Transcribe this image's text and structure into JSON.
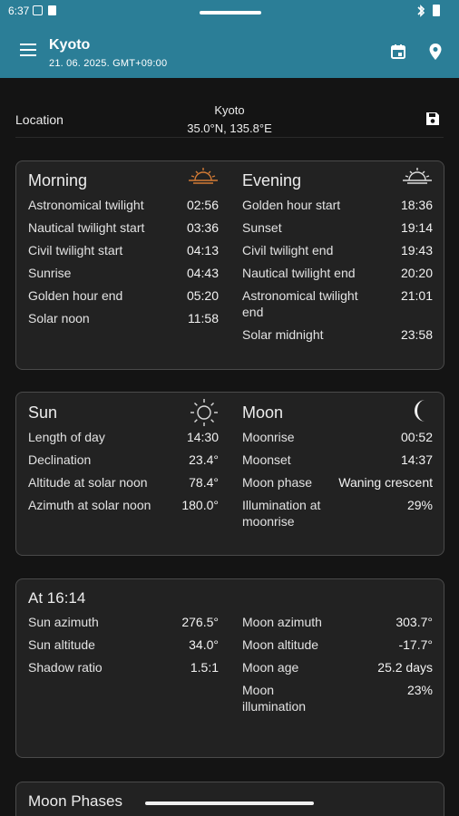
{
  "status_bar": {
    "time": "6:37"
  },
  "app_bar": {
    "title": "Kyoto",
    "subtitle": "21. 06. 2025.  GMT+09:00",
    "menu_icon": "menu-icon",
    "calendar_icon": "calendar-icon",
    "location_icon": "map-pin-icon"
  },
  "location": {
    "label": "Location",
    "name": "Kyoto",
    "coords": "35.0°N, 135.8°E",
    "save_icon": "save-icon"
  },
  "twilight_card": {
    "morning": {
      "title": "Morning",
      "icon": "sunrise-icon",
      "rows": [
        {
          "label": "Astronomical twilight",
          "value": "02:56"
        },
        {
          "label": "Nautical twilight start",
          "value": "03:36"
        },
        {
          "label": "Civil twilight start",
          "value": "04:13"
        },
        {
          "label": "Sunrise",
          "value": "04:43"
        },
        {
          "label": "Golden hour end",
          "value": "05:20"
        },
        {
          "label": "Solar noon",
          "value": "11:58"
        }
      ]
    },
    "evening": {
      "title": "Evening",
      "icon": "sunset-icon",
      "rows": [
        {
          "label": "Golden hour start",
          "value": "18:36"
        },
        {
          "label": "Sunset",
          "value": "19:14"
        },
        {
          "label": "Civil twilight end",
          "value": "19:43"
        },
        {
          "label": "Nautical twilight end",
          "value": "20:20"
        },
        {
          "label": "Astronomical twilight end",
          "value": "21:01"
        },
        {
          "label": "Solar midnight",
          "value": "23:58"
        }
      ]
    }
  },
  "sun_moon_card": {
    "sun": {
      "title": "Sun",
      "icon": "sun-icon",
      "rows": [
        {
          "label": "Length of day",
          "value": "14:30"
        },
        {
          "label": "Declination",
          "value": "23.4°"
        },
        {
          "label": "Altitude at solar noon",
          "value": "78.4°"
        },
        {
          "label": "Azimuth at solar noon",
          "value": "180.0°"
        }
      ]
    },
    "moon": {
      "title": "Moon",
      "icon": "crescent-moon-icon",
      "rows": [
        {
          "label": "Moonrise",
          "value": "00:52"
        },
        {
          "label": "Moonset",
          "value": "14:37"
        },
        {
          "label": "Moon phase",
          "value": "Waning crescent"
        },
        {
          "label": "Illumination at moonrise",
          "value": "29%"
        }
      ]
    }
  },
  "now_card": {
    "title": "At 16:14",
    "left_rows": [
      {
        "label": "Sun azimuth",
        "value": "276.5°"
      },
      {
        "label": "Sun altitude",
        "value": "34.0°"
      },
      {
        "label": "Shadow ratio",
        "value": "1.5:1"
      }
    ],
    "right_rows": [
      {
        "label": "Moon azimuth",
        "value": "303.7°"
      },
      {
        "label": "Moon altitude",
        "value": "-17.7°"
      },
      {
        "label": "Moon age",
        "value": "25.2 days"
      },
      {
        "label": "Moon illumination",
        "value": "23%"
      }
    ]
  },
  "phases_card": {
    "title": "Moon Phases"
  },
  "colors": {
    "accent": "#2b7e97",
    "card": "#222222",
    "sunrise_icon": "#d27a35"
  }
}
